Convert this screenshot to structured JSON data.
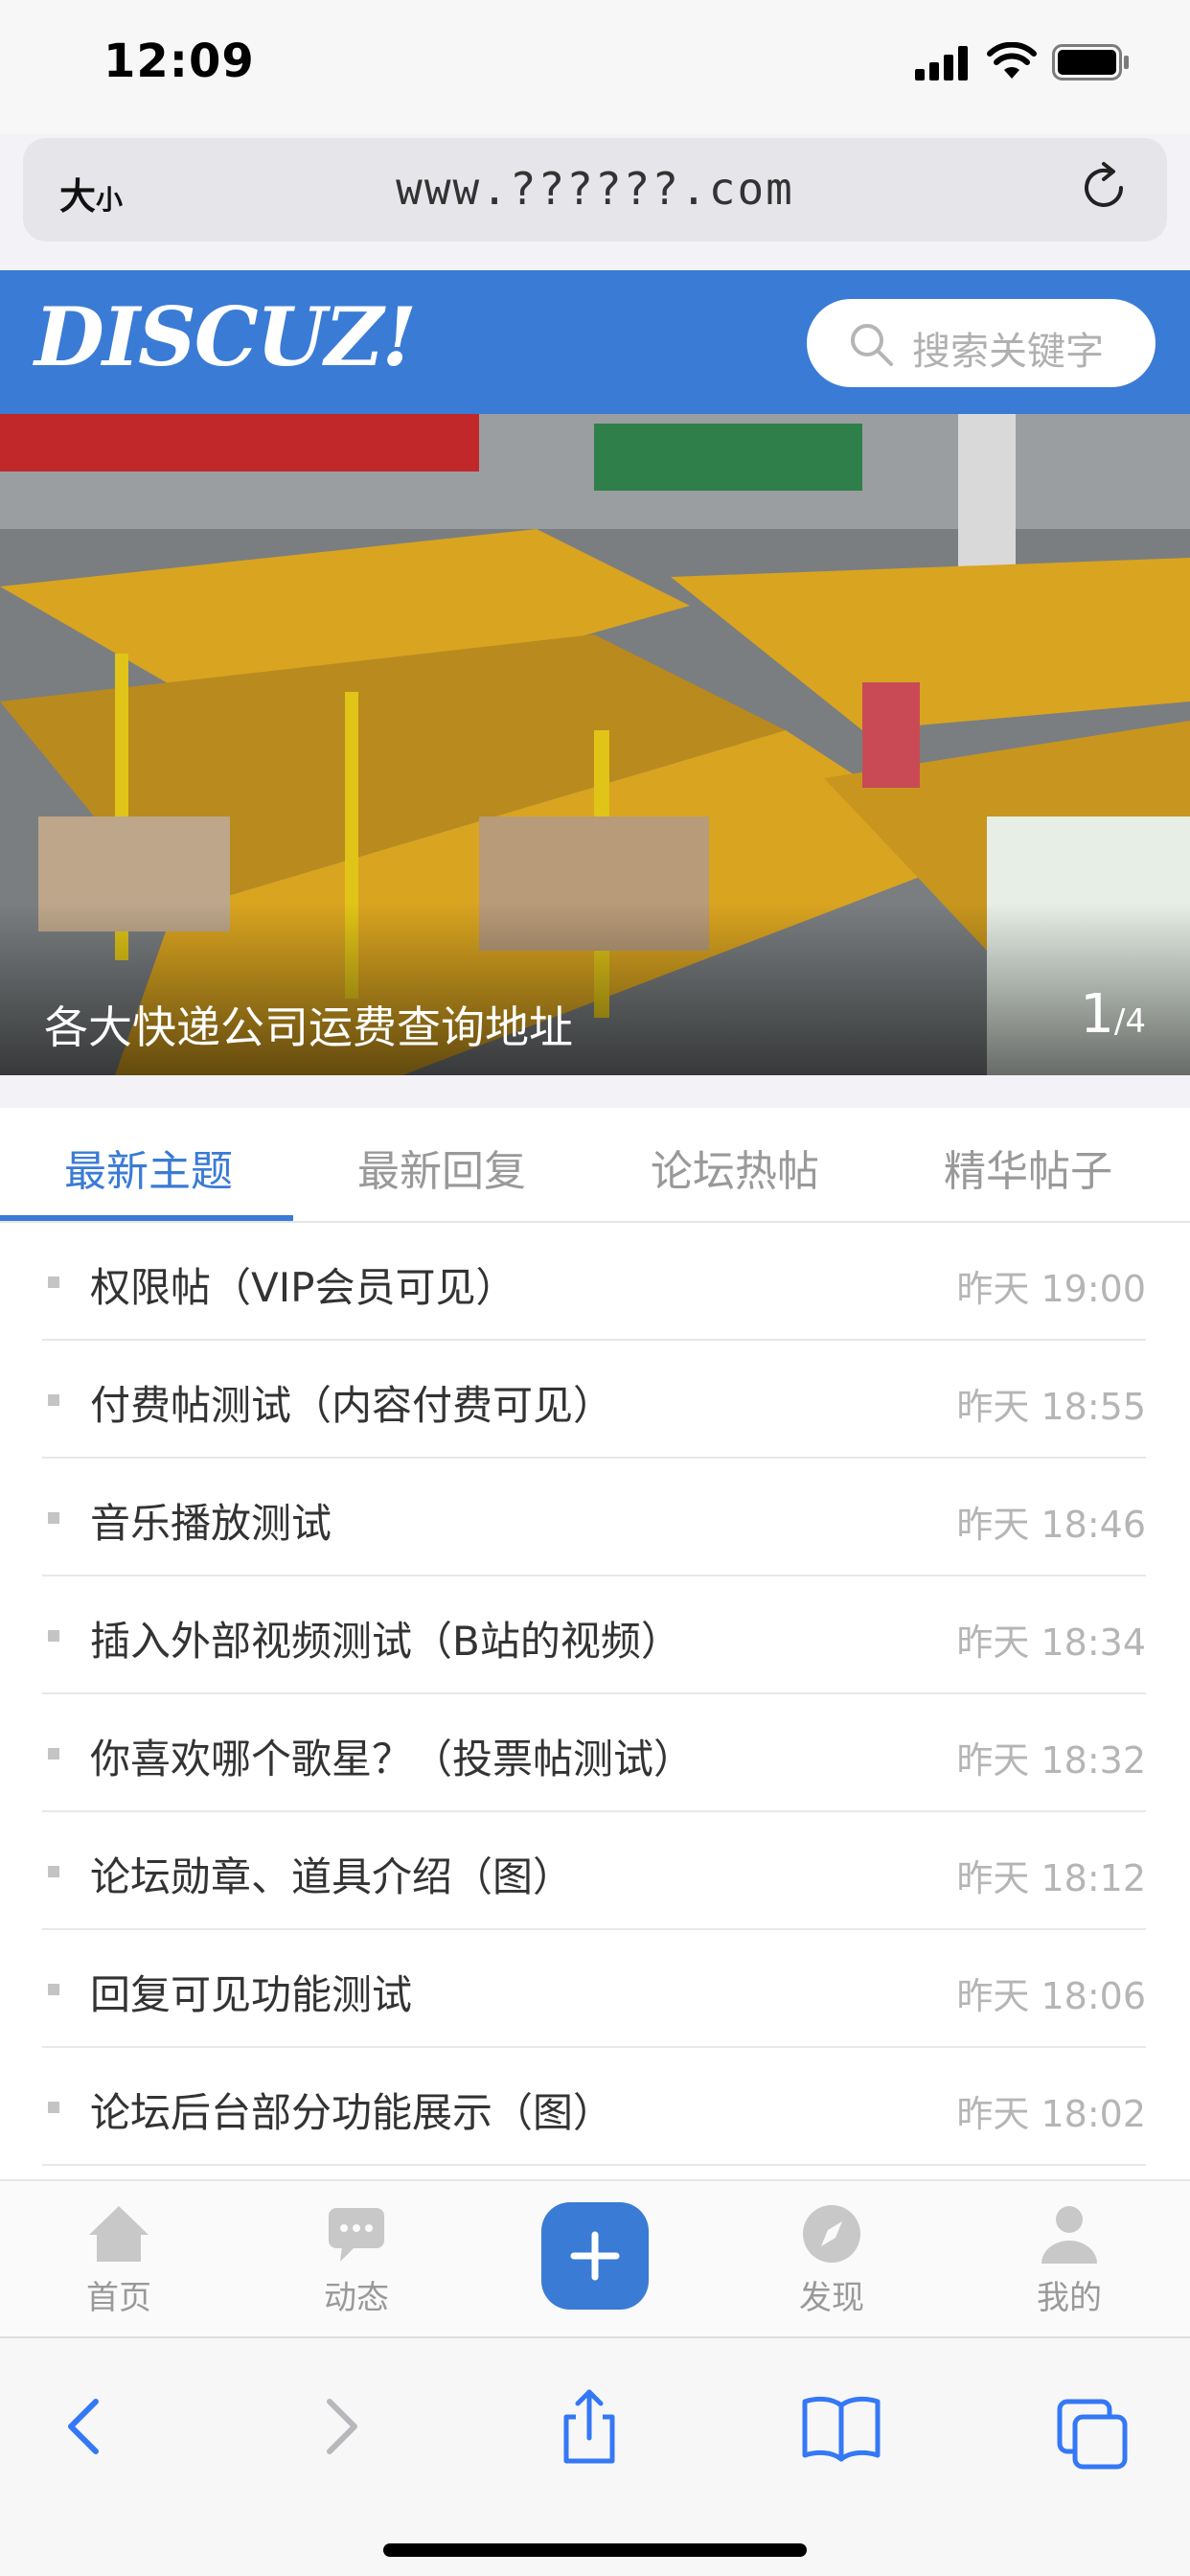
{
  "status_bar": {
    "time": "12:09"
  },
  "address_bar": {
    "text_size_label": "大",
    "text_size_small": "小",
    "url": "www.??????.com"
  },
  "header": {
    "logo": "DISCUZ!",
    "search_placeholder": "搜索关键字"
  },
  "banner": {
    "caption": "各大快递公司运费查询地址",
    "current": "1",
    "separator": "/",
    "total": "4"
  },
  "tabs": [
    "最新主题",
    "最新回复",
    "论坛热帖",
    "精华帖子"
  ],
  "active_tab": 0,
  "threads": [
    {
      "title": "权限帖（VIP会员可见）",
      "time": "昨天 19:00"
    },
    {
      "title": "付费帖测试（内容付费可见）",
      "time": "昨天 18:55"
    },
    {
      "title": "音乐播放测试",
      "time": "昨天 18:46"
    },
    {
      "title": "插入外部视频测试（B站的视频）",
      "time": "昨天 18:34"
    },
    {
      "title": "你喜欢哪个歌星？（投票帖测试）",
      "time": "昨天 18:32"
    },
    {
      "title": "论坛勋章、道具介绍（图）",
      "time": "昨天 18:12"
    },
    {
      "title": "回复可见功能测试",
      "time": "昨天 18:06"
    },
    {
      "title": "论坛后台部分功能展示（图）",
      "time": "昨天 18:02"
    }
  ],
  "bottom_nav": [
    {
      "label": "首页",
      "icon": "home-icon"
    },
    {
      "label": "动态",
      "icon": "chat-icon"
    },
    {
      "label": "",
      "icon": "plus-icon"
    },
    {
      "label": "发现",
      "icon": "compass-icon"
    },
    {
      "label": "我的",
      "icon": "user-icon"
    }
  ],
  "colors": {
    "brand": "#3a7bd5",
    "safari_tint": "#3478f6"
  }
}
